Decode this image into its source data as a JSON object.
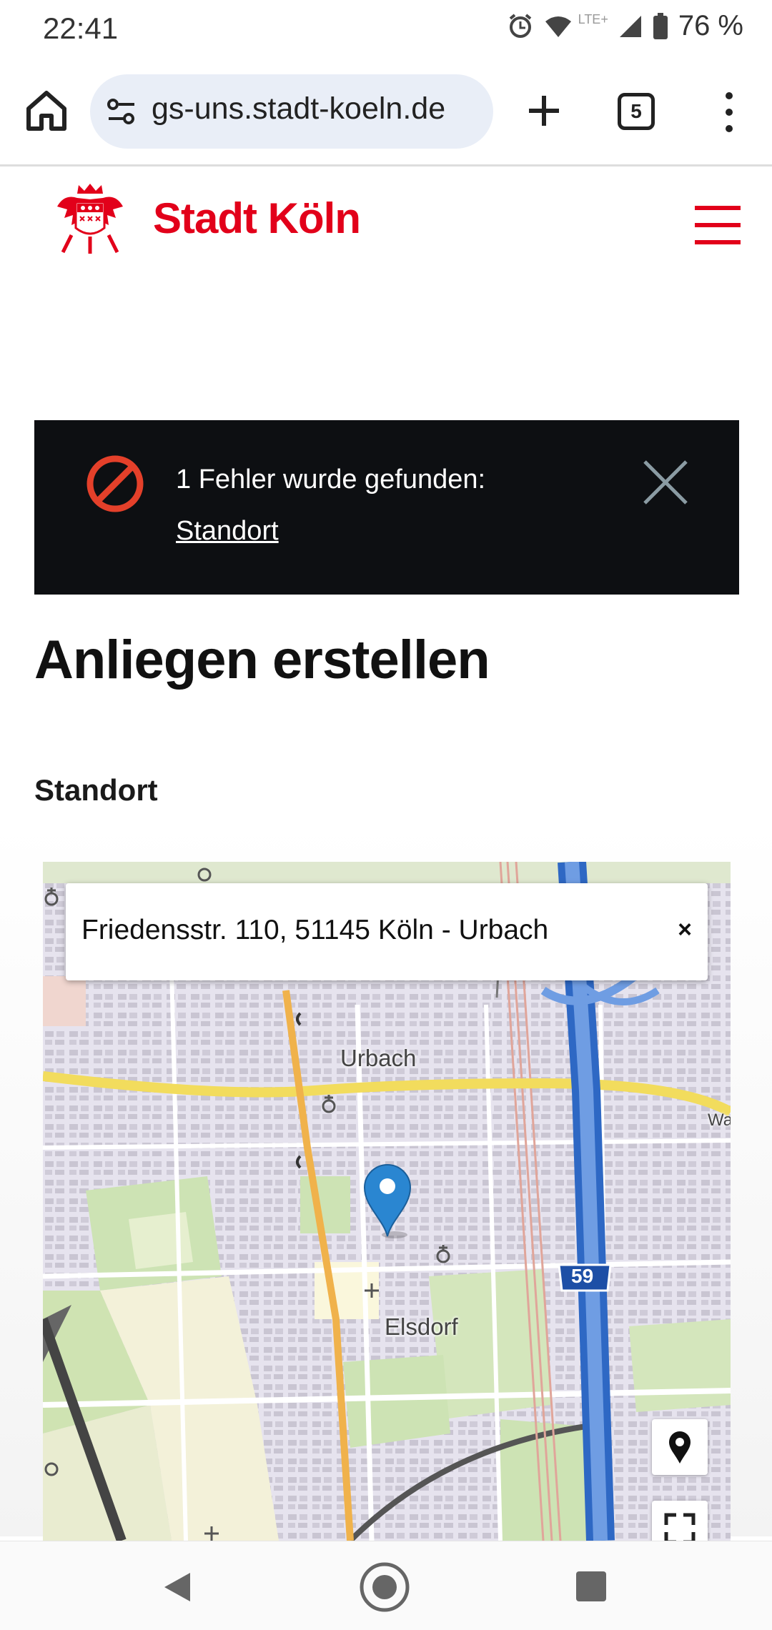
{
  "status_bar": {
    "time": "22:41",
    "battery": "76 %",
    "network": "LTE+"
  },
  "browser": {
    "url": "gs-uns.stadt-koeln.de",
    "tab_count": "5"
  },
  "header": {
    "brand": "Stadt Köln"
  },
  "error": {
    "message": "1 Fehler wurde gefunden:",
    "link": "Standort"
  },
  "page": {
    "title": "Anliegen erstellen",
    "section_label": "Standort"
  },
  "map": {
    "address": "Friedensstr. 110, 51145 Köln - Urbach",
    "clear_label": "×",
    "places": [
      "Urbach",
      "Elsdorf"
    ],
    "road_label": "Wa",
    "highway_number": "59"
  },
  "colors": {
    "brand": "#e2001a",
    "error_bg": "#0d0f12",
    "marker": "#2a86d1",
    "highway": "#4d86d8"
  }
}
